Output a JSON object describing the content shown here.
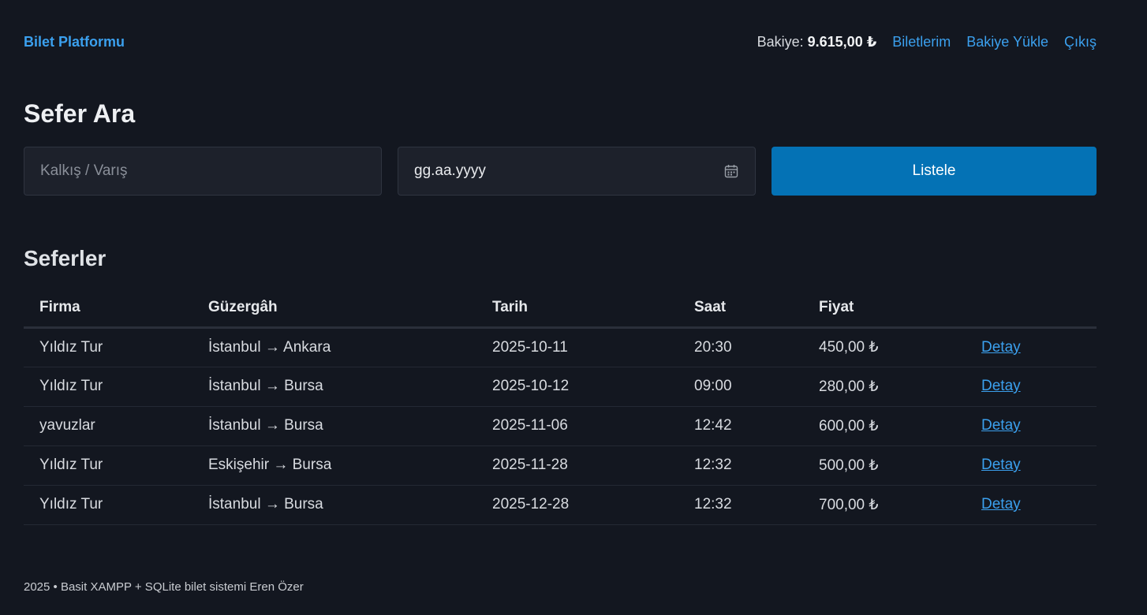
{
  "header": {
    "brand": "Bilet Platformu",
    "balance_label": "Bakiye:",
    "balance_value": "9.615,00 ₺",
    "nav": [
      "Biletlerim",
      "Bakiye Yükle",
      "Çıkış"
    ]
  },
  "search": {
    "title": "Sefer Ara",
    "route_placeholder": "Kalkış / Varış",
    "date_value": "gg.aa.yyyy",
    "date_icon": "calendar-icon",
    "submit_label": "Listele"
  },
  "trips": {
    "title": "Seferler",
    "columns": [
      "Firma",
      "Güzergâh",
      "Tarih",
      "Saat",
      "Fiyat",
      ""
    ],
    "rows": [
      {
        "company": "Yıldız Tur",
        "route": "İstanbul → Ankara",
        "date": "2025-10-11",
        "time": "20:30",
        "price": "450,00 ₺",
        "action": "Detay"
      },
      {
        "company": "Yıldız Tur",
        "route": "İstanbul → Bursa",
        "date": "2025-10-12",
        "time": "09:00",
        "price": "280,00 ₺",
        "action": "Detay"
      },
      {
        "company": "yavuzlar",
        "route": "İstanbul → Bursa",
        "date": "2025-11-06",
        "time": "12:42",
        "price": "600,00 ₺",
        "action": "Detay"
      },
      {
        "company": "Yıldız Tur",
        "route": "Eskişehir → Bursa",
        "date": "2025-11-28",
        "time": "12:32",
        "price": "500,00 ₺",
        "action": "Detay"
      },
      {
        "company": "Yıldız Tur",
        "route": "İstanbul → Bursa",
        "date": "2025-12-28",
        "time": "12:32",
        "price": "700,00 ₺",
        "action": "Detay"
      }
    ]
  },
  "footer": {
    "text": "2025 • Basit XAMPP + SQLite bilet sistemi Eren Özer"
  },
  "colors": {
    "background": "#131720",
    "accent": "#3ba0ee",
    "primary_button": "#0472b5",
    "input_background": "#1d212b"
  }
}
